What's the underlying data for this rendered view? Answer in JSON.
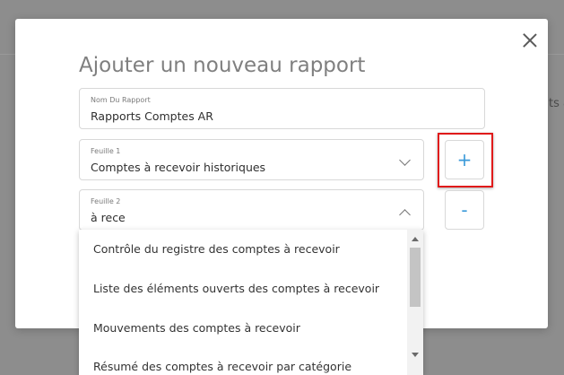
{
  "background": {
    "peek_text": "ts a"
  },
  "modal": {
    "title": "Ajouter un nouveau rapport",
    "close_icon": "close-icon"
  },
  "report_name": {
    "label": "Nom Du Rapport",
    "value": "Rapports Comptes AR"
  },
  "sheet1": {
    "label": "Feuille 1",
    "value": "Comptes à recevoir historiques",
    "icon": "chevron-down-icon"
  },
  "sheet2": {
    "label": "Feuille 2",
    "value": "à rece",
    "icon": "chevron-up-icon"
  },
  "buttons": {
    "add_label": "+",
    "remove_label": "-"
  },
  "dropdown": {
    "items": [
      "Contrôle du registre des comptes à recevoir",
      "Liste des éléments ouverts des comptes à recevoir",
      "Mouvements des comptes à recevoir",
      "Résumé des comptes à recevoir par catégorie"
    ]
  },
  "colors": {
    "accent": "#3b9ad9",
    "highlight": "#e01a1a"
  }
}
